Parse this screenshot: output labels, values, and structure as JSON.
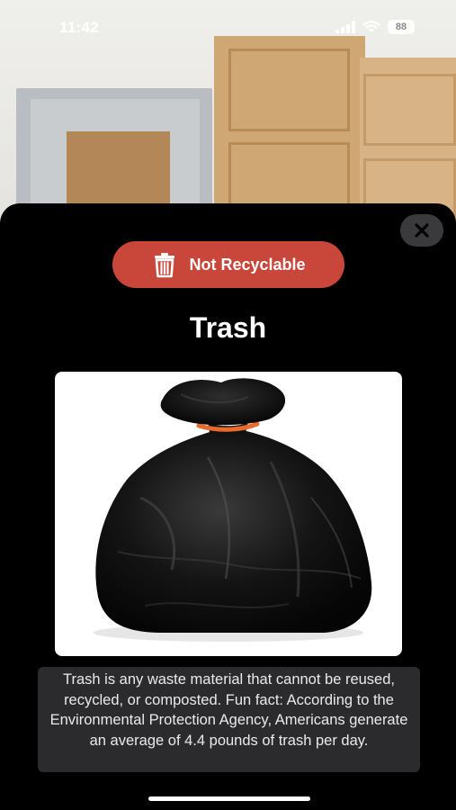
{
  "status_bar": {
    "time": "11:42",
    "battery": "88",
    "icons": [
      "signal-icon",
      "wifi-icon",
      "battery-icon"
    ]
  },
  "result": {
    "badge_label": "Not Recyclable",
    "badge_icon": "trash-can-icon",
    "badge_color": "#c8463a",
    "item_name": "Trash",
    "image_subject": "black-trash-bag",
    "description": "Trash is any waste material that cannot be reused, recycled, or composted. Fun fact: According to the Environmental Protection Agency, Americans generate an average of 4.4 pounds of trash per day."
  },
  "controls": {
    "close_icon": "close-icon"
  }
}
